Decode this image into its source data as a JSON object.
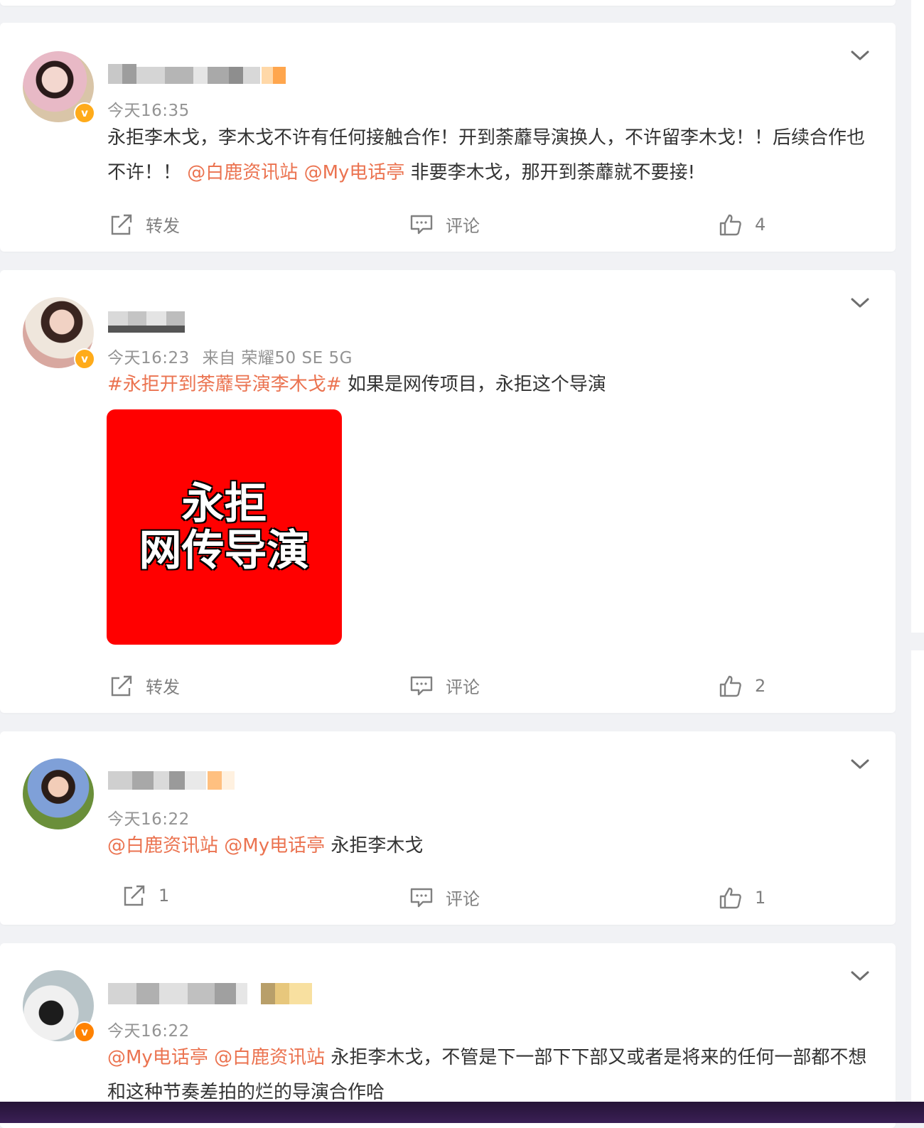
{
  "posts": [
    {
      "time": "今天16:35",
      "text_before": "永拒李木戈，李木戈不许有任何接触合作！开到荼蘼导演换人，不许留李木戈！！后续合作也不许！！",
      "mention1": "@白鹿资讯站",
      "mention2": "@My电话亭",
      "text_after": "非要李木戈，那开到荼蘼就不要接!",
      "repost": "转发",
      "comment": "评论",
      "likes": "4"
    },
    {
      "time": "今天16:23",
      "source": "来自 荣耀50 SE 5G",
      "hashtag": "#永拒开到荼蘼导演李木戈#",
      "text_after": "如果是网传项目，永拒这个导演",
      "image_line1": "永拒",
      "image_line2": "网传导演",
      "repost": "转发",
      "comment": "评论",
      "likes": "2"
    },
    {
      "time": "今天16:22",
      "mention1": "@白鹿资讯站",
      "mention2": "@My电话亭",
      "text_after": "永拒李木戈",
      "reposts": "1",
      "comment": "评论",
      "likes": "1"
    },
    {
      "time": "今天16:22",
      "mention1": "@My电话亭",
      "mention2": "@白鹿资讯站",
      "text_after": "永拒李木戈，不管是下一部下下部又或者是将来的任何一部都不想和这种节奏差拍的烂的导演合作哈"
    }
  ],
  "colors": {
    "link": "#eb7350",
    "badge": "#ffab1a",
    "badge_orange": "#ff8200",
    "image_bg": "#ff0000"
  },
  "icons": [
    "repost-icon",
    "comment-icon",
    "like-icon",
    "chevron-down-icon",
    "verified-badge"
  ]
}
